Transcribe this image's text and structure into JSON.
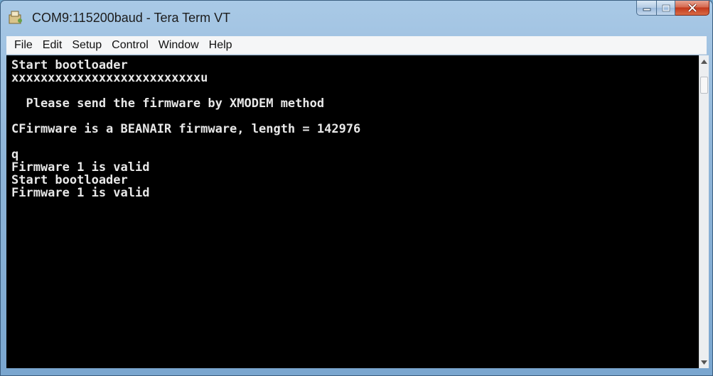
{
  "window": {
    "title": "COM9:115200baud - Tera Term VT",
    "icon": "tera-term-app-icon",
    "controls": [
      "minimize",
      "maximize",
      "close"
    ]
  },
  "menu": {
    "items": [
      {
        "label": "File"
      },
      {
        "label": "Edit"
      },
      {
        "label": "Setup"
      },
      {
        "label": "Control"
      },
      {
        "label": "Window"
      },
      {
        "label": "Help"
      }
    ]
  },
  "terminal": {
    "lines": [
      "Start bootloader",
      "xxxxxxxxxxxxxxxxxxxxxxxxxxu",
      "",
      "  Please send the firmware by XMODEM method",
      "",
      "CFirmware is a BEANAIR firmware, length = 142976",
      "",
      "q",
      "Firmware 1 is valid",
      "Start bootloader",
      "Firmware 1 is valid"
    ]
  },
  "colors": {
    "terminal_bg": "#000000",
    "terminal_fg": "#e8e8e8",
    "titlebar": "#a9c9e6",
    "close_button": "#c2381c"
  }
}
